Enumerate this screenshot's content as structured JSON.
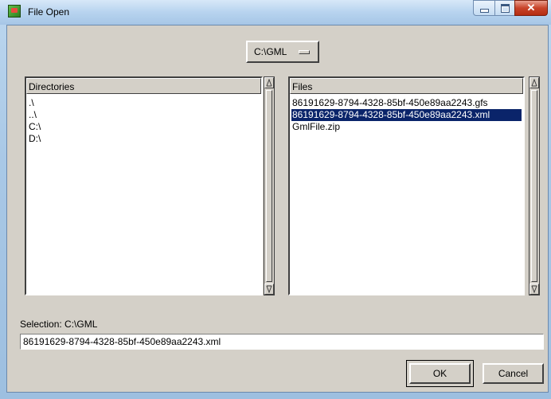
{
  "window": {
    "title": "File Open",
    "minimize_glyph": "",
    "maximize_glyph": "",
    "close_glyph": "✕"
  },
  "drive": {
    "label": "C:\\GML"
  },
  "directories": {
    "header": "Directories",
    "items": [
      ".\\",
      "..\\",
      "C:\\",
      "D:\\"
    ]
  },
  "files": {
    "header": "Files",
    "items": [
      "86191629-8794-4328-85bf-450e89aa2243.gfs",
      "86191629-8794-4328-85bf-450e89aa2243.xml",
      "GmlFile.zip"
    ],
    "selected_index": 1
  },
  "selection": {
    "label": "Selection: C:\\GML",
    "value": "86191629-8794-4328-85bf-450e89aa2243.xml"
  },
  "buttons": {
    "ok": "OK",
    "cancel": "Cancel"
  },
  "colors": {
    "selection_bg": "#0a246a",
    "dialog_bg": "#d4d0c8",
    "close_button": "#c8442a"
  }
}
